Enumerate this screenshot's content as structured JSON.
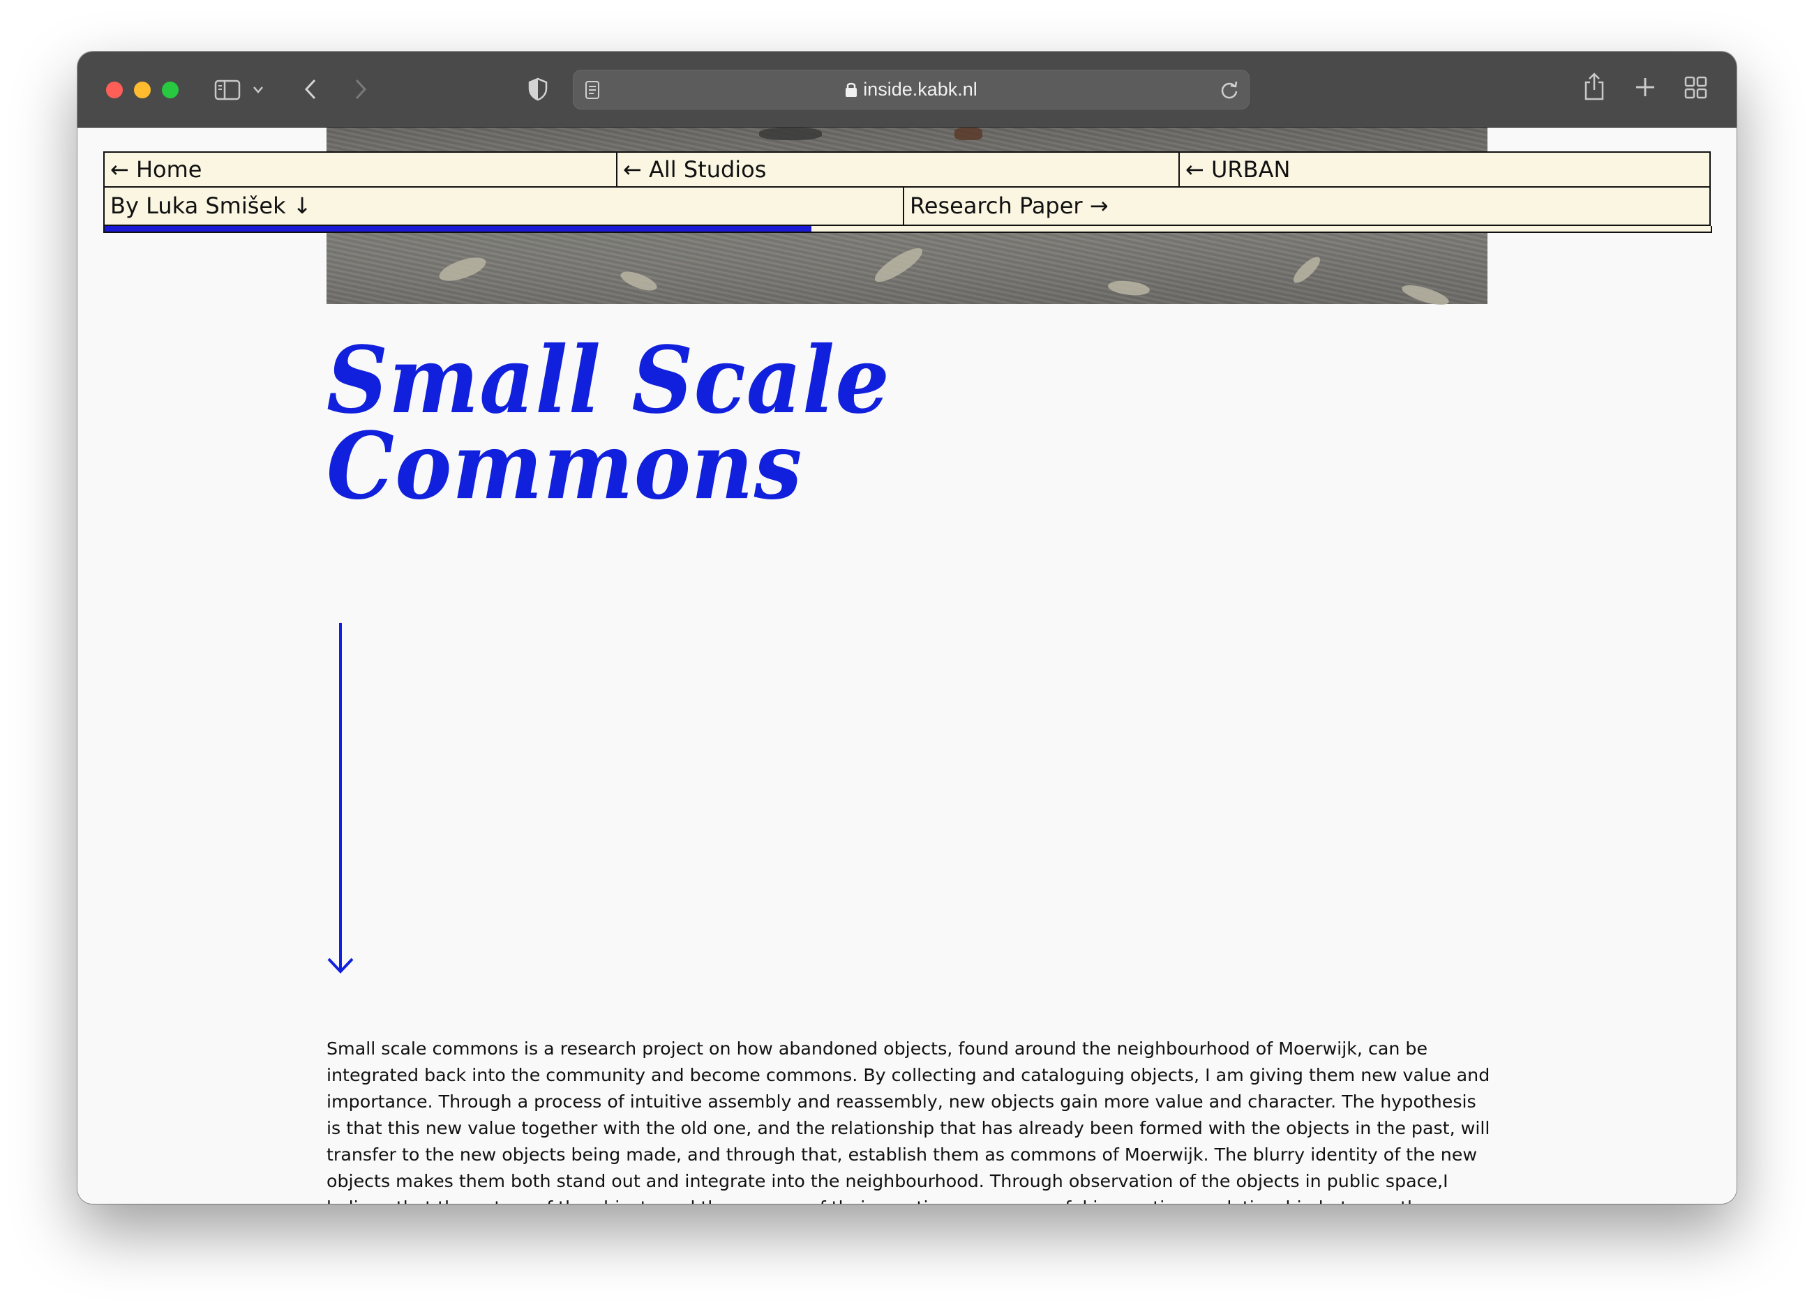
{
  "browser": {
    "url": "inside.kabk.nl"
  },
  "nav": {
    "home": "← Home",
    "all_studios": "← All Studios",
    "urban": "← URBAN",
    "author": "By Luka Smišek ↓",
    "research_paper": "Research Paper →"
  },
  "reading_progress_percent": 44,
  "article": {
    "title_line1": "Small Scale",
    "title_line2": "Commons",
    "body": "Small scale commons is a research project on how abandoned objects, found around the neighbourhood of Moerwijk, can be integrated back into the community and become commons. By collecting and cataloguing objects, I am giving them new value and importance. Through a process of intuitive assembly and reassembly, new objects gain more value and character. The hypothesis is that this new value together with the old one, and the relationship that has already been formed with the objects in the past, will transfer to the new objects being made, and through that, establish them as commons of Moerwijk. The blurry identity of the new objects makes them both stand out and integrate into the neighbourhood. Through observation of the objects in public space,I believe that the nature of the objects and the process of their creation was successful in creating a relationship between the people and the objects in Moerwijk."
  },
  "colors": {
    "accent_blue": "#1020dc",
    "nav_background": "#faf6e2"
  },
  "icons": [
    "sidebar-icon",
    "chevron-down-icon",
    "back-icon",
    "forward-icon",
    "shield-icon",
    "reader-icon",
    "lock-icon",
    "reload-icon",
    "share-icon",
    "new-tab-icon",
    "tab-overview-icon",
    "scroll-down-arrow-icon"
  ]
}
